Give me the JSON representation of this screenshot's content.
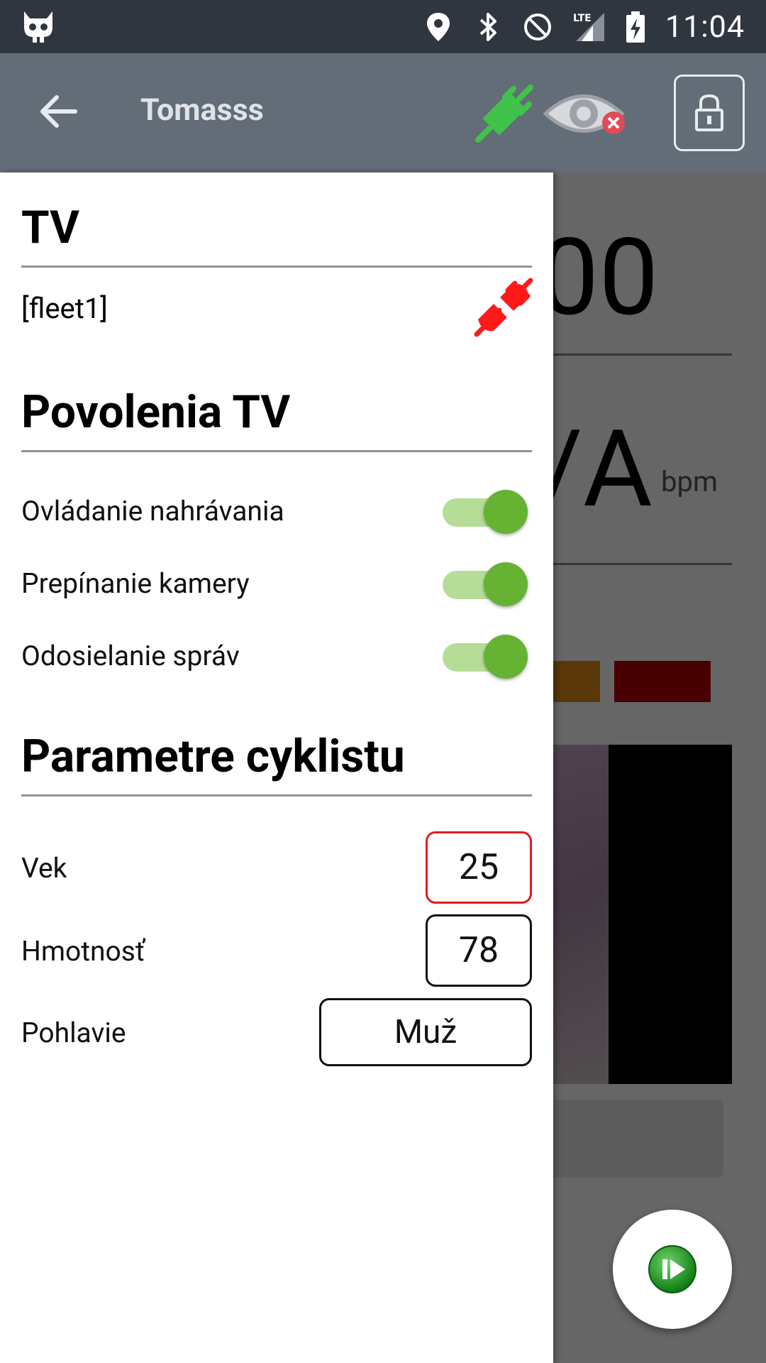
{
  "status_bar": {
    "time": "11:04",
    "icons": [
      "cyanogen-bot-icon",
      "location-icon",
      "bluetooth-icon",
      "do-not-disturb-icon",
      "lte-signal-icon",
      "battery-charging-icon"
    ]
  },
  "app_bar": {
    "title": "Tomasss",
    "icons": [
      "back-arrow-icon",
      "plug-connected-icon",
      "eye-disabled-icon",
      "lock-icon"
    ]
  },
  "background": {
    "value_top": "00",
    "value_mid": "/A",
    "unit": "bpm"
  },
  "drawer": {
    "tv_section": {
      "title": "TV",
      "fleet": "[fleet1]",
      "status_icon": "plug-disconnected-icon"
    },
    "permissions_section": {
      "title": "Povolenia TV",
      "items": [
        {
          "label": "Ovládanie nahrávania",
          "enabled": true
        },
        {
          "label": "Prepínanie kamery",
          "enabled": true
        },
        {
          "label": "Odosielanie správ",
          "enabled": true
        }
      ]
    },
    "cyclist_section": {
      "title": "Parametre cyklistu",
      "age_label": "Vek",
      "age_value": "25",
      "weight_label": "Hmotnosť",
      "weight_value": "78",
      "gender_label": "Pohlavie",
      "gender_value": "Muž"
    }
  },
  "fab": {
    "icon": "play-next-icon"
  },
  "colors": {
    "status_bar": "#2f3640",
    "app_bar": "#626d78",
    "switch_on": "#66b232",
    "error_border": "#e31b1b",
    "plug_connected": "#41c24a",
    "plug_disconnected": "#ff1a1a"
  }
}
